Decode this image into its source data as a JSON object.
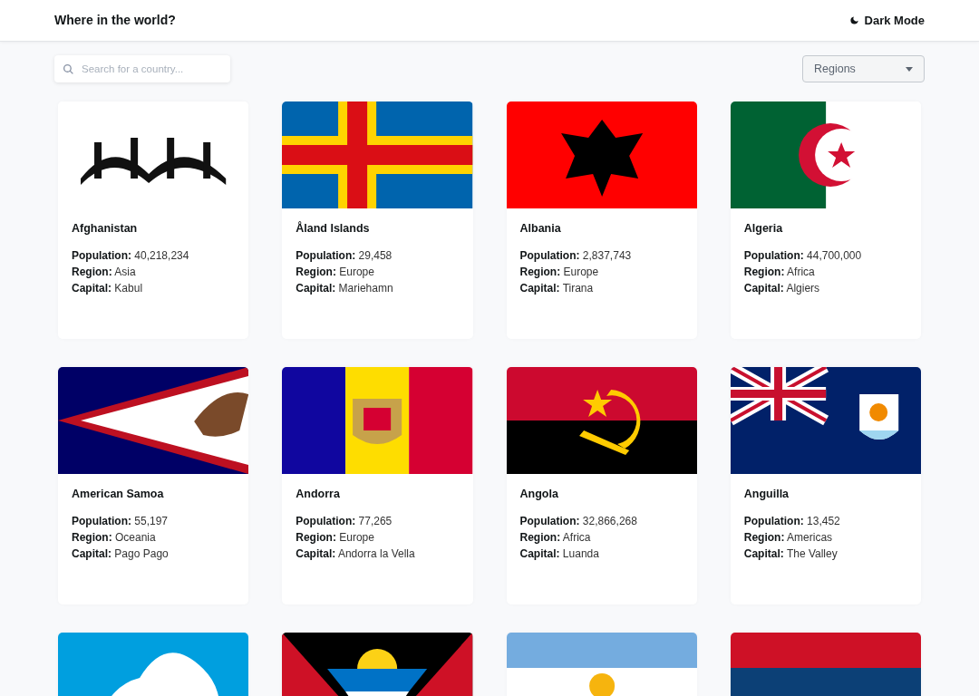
{
  "header": {
    "title": "Where in the world?",
    "theme_toggle": "Dark Mode"
  },
  "search": {
    "placeholder": "Search for a country..."
  },
  "region_filter": {
    "value": "Regions"
  },
  "cards": [
    {
      "flag": {
        "kind": "picture"
      },
      "name": "Afghanistan",
      "fields": [
        {
          "label": "Population:",
          "value": "40,218,234"
        },
        {
          "label": "Region:",
          "value": "Asia"
        },
        {
          "label": "Capital:",
          "value": "Kabul"
        }
      ]
    },
    {
      "flag": {
        "kind": "picture"
      },
      "name": "Åland Islands",
      "fields": [
        {
          "label": "Population:",
          "value": "29,458"
        },
        {
          "label": "Region:",
          "value": "Europe"
        },
        {
          "label": "Capital:",
          "value": "Mariehamn"
        }
      ]
    },
    {
      "flag": {
        "kind": "picture"
      },
      "name": "Albania",
      "fields": [
        {
          "label": "Population:",
          "value": "2,837,743"
        },
        {
          "label": "Region:",
          "value": "Europe"
        },
        {
          "label": "Capital:",
          "value": "Tirana"
        }
      ]
    },
    {
      "flag": {
        "kind": "picture"
      },
      "name": "Algeria",
      "fields": [
        {
          "label": "Population:",
          "value": "44,700,000"
        },
        {
          "label": "Region:",
          "value": "Africa"
        },
        {
          "label": "Capital:",
          "value": "Algiers"
        }
      ]
    },
    {
      "flag": {
        "kind": "picture"
      },
      "name": "American Samoa",
      "fields": [
        {
          "label": "Population:",
          "value": "55,197"
        },
        {
          "label": "Region:",
          "value": "Oceania"
        },
        {
          "label": "Capital:",
          "value": "Pago Pago"
        }
      ]
    },
    {
      "flag": {
        "kind": "picture"
      },
      "name": "Andorra",
      "fields": [
        {
          "label": "Population:",
          "value": "77,265"
        },
        {
          "label": "Region:",
          "value": "Europe"
        },
        {
          "label": "Capital:",
          "value": "Andorra la Vella"
        }
      ]
    },
    {
      "flag": {
        "kind": "picture"
      },
      "name": "Angola",
      "fields": [
        {
          "label": "Population:",
          "value": "32,866,268"
        },
        {
          "label": "Region:",
          "value": "Africa"
        },
        {
          "label": "Capital:",
          "value": "Luanda"
        }
      ]
    },
    {
      "flag": {
        "kind": "picture"
      },
      "name": "Anguilla",
      "fields": [
        {
          "label": "Population:",
          "value": "13,452"
        },
        {
          "label": "Region:",
          "value": "Americas"
        },
        {
          "label": "Capital:",
          "value": "The Valley"
        }
      ]
    },
    {
      "flag": {
        "kind": "picture"
      }
    },
    {
      "flag": {
        "kind": "picture"
      }
    },
    {
      "flag": {
        "kind": "picture"
      }
    },
    {
      "flag": {
        "kind": "picture"
      }
    }
  ]
}
